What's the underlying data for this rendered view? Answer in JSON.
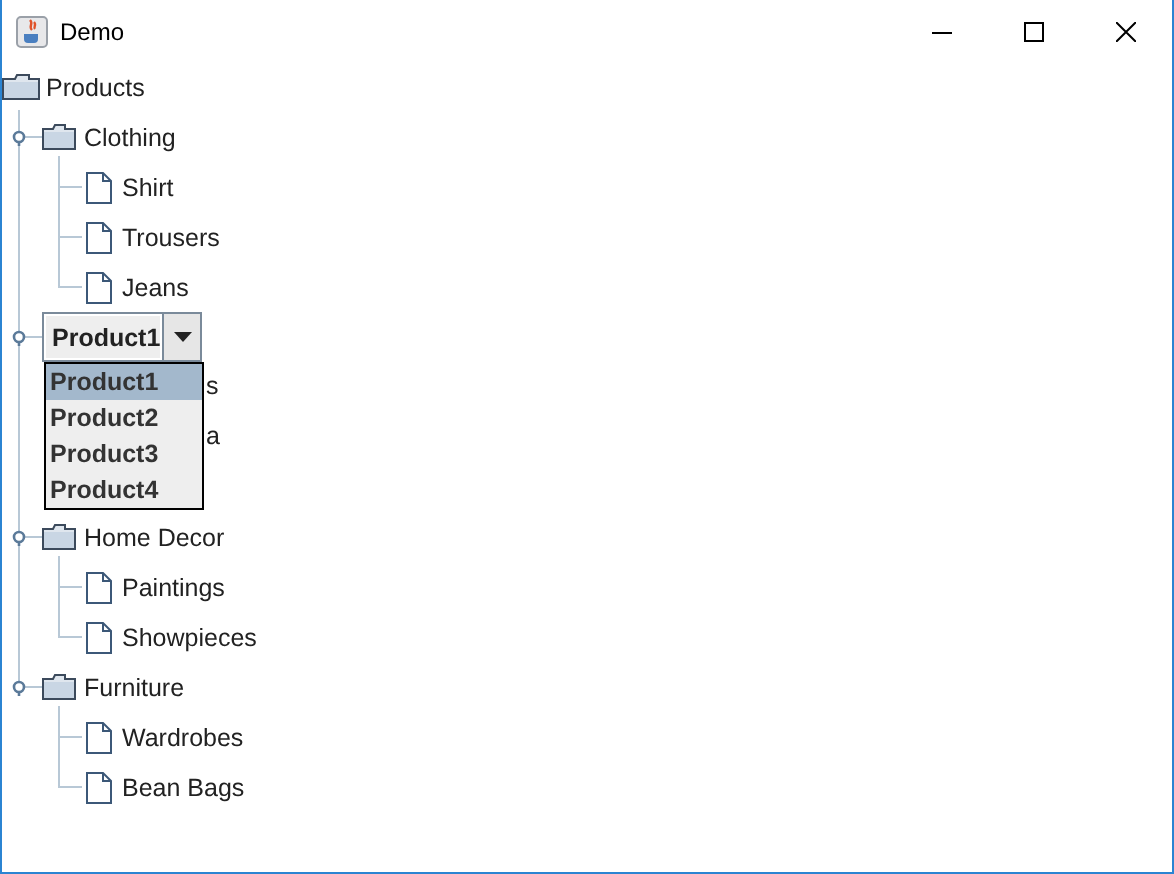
{
  "window": {
    "title": "Demo"
  },
  "tree": {
    "label": "Products",
    "children": [
      {
        "kind": "node",
        "label": "Clothing",
        "expanded": true,
        "children": [
          {
            "kind": "leaf",
            "label": "Shirt"
          },
          {
            "kind": "leaf",
            "label": "Trousers"
          },
          {
            "kind": "leaf",
            "label": "Jeans"
          }
        ]
      },
      {
        "kind": "editor",
        "expanded": true,
        "value": "Product1",
        "options": [
          {
            "label": "Product1",
            "selected": true
          },
          {
            "label": "Product2",
            "selected": false
          },
          {
            "label": "Product3",
            "selected": false
          },
          {
            "label": "Product4",
            "selected": false
          }
        ],
        "children": [
          {
            "kind": "covered",
            "label": "s"
          },
          {
            "kind": "covered",
            "label": "a"
          }
        ]
      },
      {
        "kind": "node",
        "label": "Home Decor",
        "expanded": true,
        "children": [
          {
            "kind": "leaf",
            "label": "Paintings"
          },
          {
            "kind": "leaf",
            "label": "Showpieces"
          }
        ]
      },
      {
        "kind": "node",
        "label": "Furniture",
        "expanded": true,
        "children": [
          {
            "kind": "leaf",
            "label": "Wardrobes"
          },
          {
            "kind": "leaf",
            "label": "Bean Bags"
          }
        ]
      }
    ]
  }
}
